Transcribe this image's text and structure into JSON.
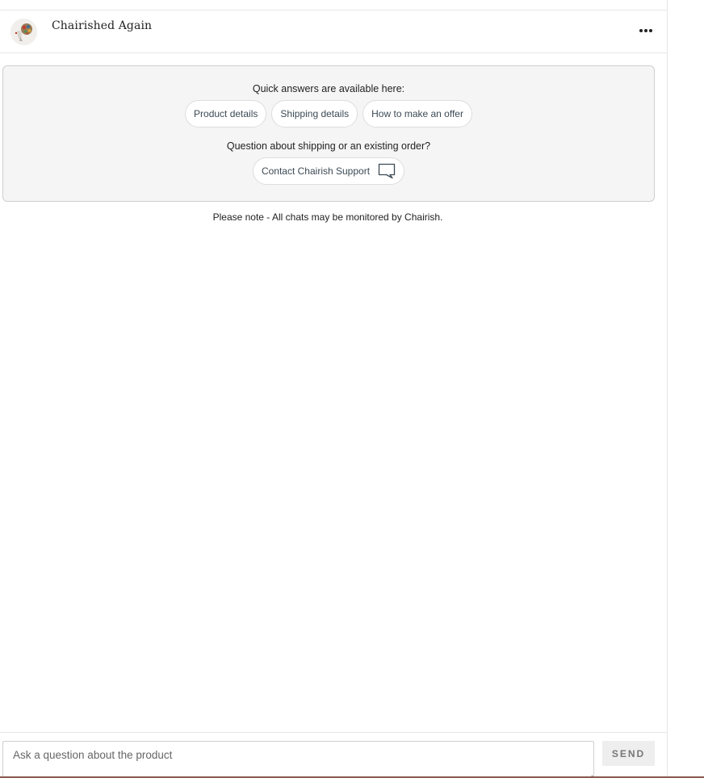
{
  "header": {
    "seller_name": "Chairished Again",
    "avatar_icon": "seller-avatar-image",
    "more_icon": "more-options-icon"
  },
  "quick_answers": {
    "heading": "Quick answers are available here:",
    "chips": [
      {
        "label": "Product details"
      },
      {
        "label": "Shipping details"
      },
      {
        "label": "How to make an offer"
      }
    ],
    "support_heading": "Question about shipping or an existing order?",
    "support_button": {
      "label": "Contact Chairish Support",
      "icon": "chat-bubble-icon"
    }
  },
  "notice": "Please note - All chats may be monitored by Chairish.",
  "composer": {
    "placeholder": "Ask a question about the product",
    "value": "",
    "send_label": "SEND"
  },
  "colors": {
    "text": "#222222",
    "chip_text": "#3c4a55",
    "box_background": "#f5f5f5",
    "border": "#cfcfcf",
    "send_background": "#eeeeee",
    "send_text": "#777777",
    "accent": "#8a5a4e"
  }
}
